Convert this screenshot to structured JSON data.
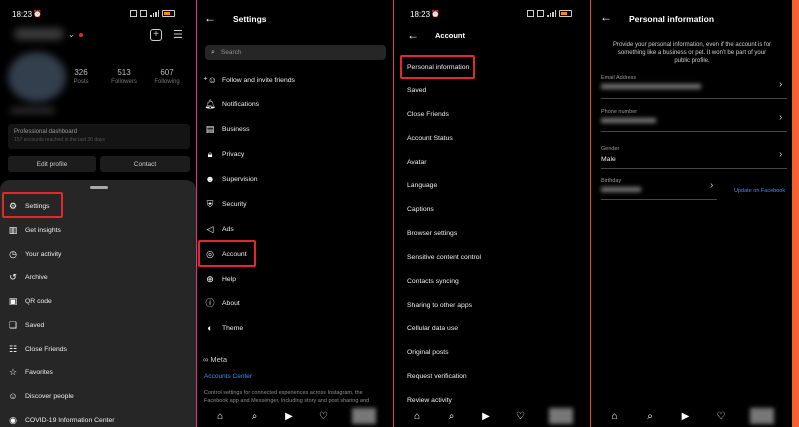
{
  "colors": {
    "highlight": "#e3262f",
    "link": "#3d8cf0",
    "background": "#000000"
  },
  "panel1": {
    "status_time": "18:23",
    "stats": [
      {
        "value": "326",
        "label": "Posts"
      },
      {
        "value": "513",
        "label": "Followers"
      },
      {
        "value": "607",
        "label": "Following"
      }
    ],
    "dashboard_title": "Professional dashboard",
    "dashboard_sub": "157 accounts reached in the last 30 days",
    "edit_profile": "Edit profile",
    "contact": "Contact",
    "menu": [
      {
        "label": "Settings",
        "icon": "settings-icon"
      },
      {
        "label": "Get insights",
        "icon": "insights-icon"
      },
      {
        "label": "Your activity",
        "icon": "activity-icon"
      },
      {
        "label": "Archive",
        "icon": "archive-icon"
      },
      {
        "label": "QR code",
        "icon": "qr-code-icon"
      },
      {
        "label": "Saved",
        "icon": "bookmark-icon"
      },
      {
        "label": "Close Friends",
        "icon": "list-icon"
      },
      {
        "label": "Favorites",
        "icon": "star-icon"
      },
      {
        "label": "Discover people",
        "icon": "add-person-icon"
      },
      {
        "label": "COVID-19 Information Center",
        "icon": "info-icon"
      }
    ]
  },
  "panel2": {
    "title": "Settings",
    "search_placeholder": "Search",
    "items": [
      {
        "label": "Follow and invite friends",
        "icon": "add-person-icon"
      },
      {
        "label": "Notifications",
        "icon": "bell-icon"
      },
      {
        "label": "Business",
        "icon": "shop-icon"
      },
      {
        "label": "Privacy",
        "icon": "lock-icon"
      },
      {
        "label": "Supervision",
        "icon": "supervision-icon"
      },
      {
        "label": "Security",
        "icon": "shield-icon"
      },
      {
        "label": "Ads",
        "icon": "megaphone-icon"
      },
      {
        "label": "Account",
        "icon": "account-icon"
      },
      {
        "label": "Help",
        "icon": "help-icon"
      },
      {
        "label": "About",
        "icon": "about-icon"
      },
      {
        "label": "Theme",
        "icon": "palette-icon"
      }
    ],
    "meta_label": "Meta",
    "accounts_center": "Accounts Center",
    "footer_text": "Control settings for connected experiences across Instagram, the Facebook app and Messenger, including story and post sharing and"
  },
  "panel3": {
    "status_time": "18:23",
    "title": "Account",
    "items": [
      "Personal information",
      "Saved",
      "Close Friends",
      "Account Status",
      "Avatar",
      "Language",
      "Captions",
      "Browser settings",
      "Sensitive content control",
      "Contacts syncing",
      "Sharing to other apps",
      "Cellular data use",
      "Original posts",
      "Request verification",
      "Review activity"
    ]
  },
  "panel4": {
    "title": "Personal information",
    "intro": "Provide your personal information, even if the account is for something like a business or pet. It won't be part of your public profile.",
    "email_label": "Email Address",
    "phone_label": "Phone number",
    "gender_label": "Gender",
    "gender_value": "Male",
    "birthday_label": "Birthday",
    "update_facebook": "Update on Facebook"
  }
}
